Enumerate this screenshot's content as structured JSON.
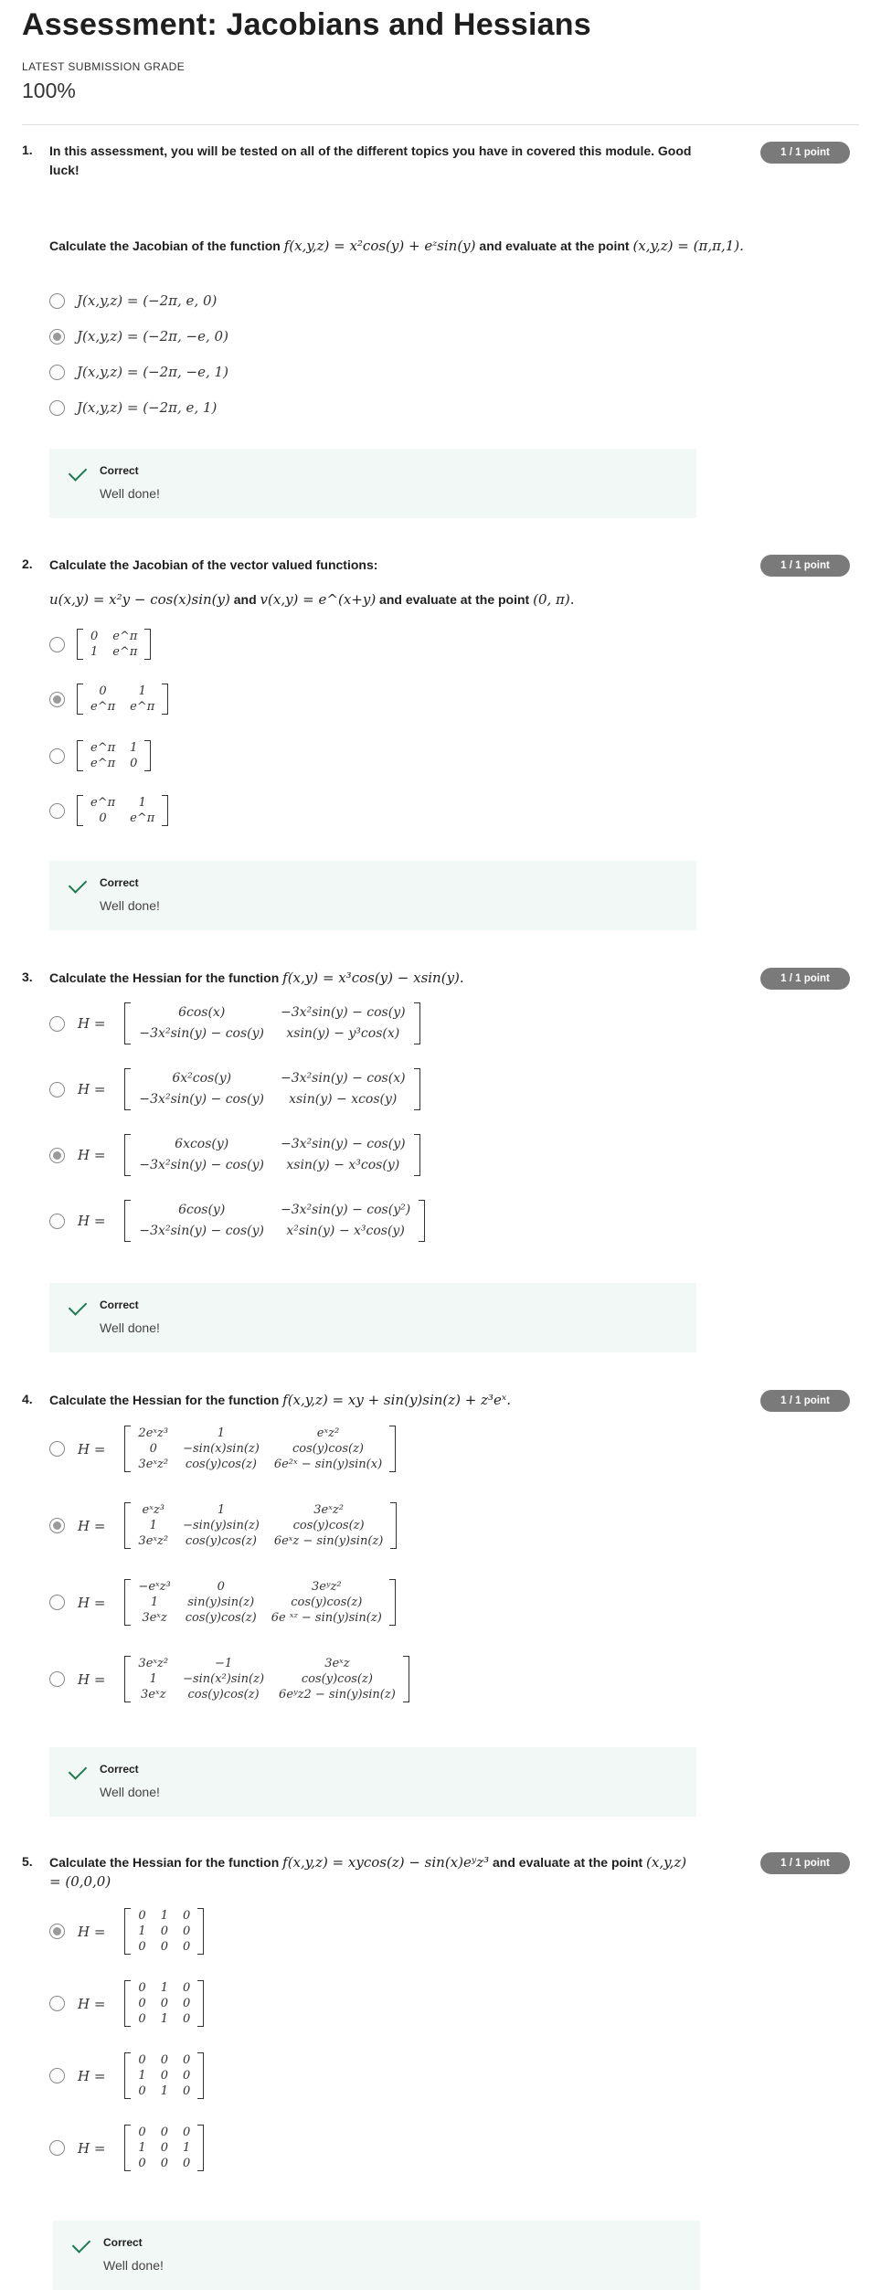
{
  "page": {
    "title": "Assessment: Jacobians and Hessians",
    "grade_label": "LATEST SUBMISSION GRADE",
    "grade_value": "100%"
  },
  "feedback": {
    "title": "Correct",
    "text": "Well done!"
  },
  "questions": [
    {
      "number": "1.",
      "badge": "1 / 1 point",
      "intro": "In this assessment, you will be tested on all of the different topics you have in covered this module. Good luck!",
      "text_parts": [
        "Calculate the Jacobian of the function ",
        "f(x,y,z) = x²cos(y) + eᶻsin(y)",
        " and evaluate at the point ",
        "(x,y,z) = (π,π,1)."
      ],
      "options": [
        "J(x,y,z) = (−2π, e, 0)",
        "J(x,y,z) = (−2π, −e, 0)",
        "J(x,y,z) = (−2π, −e, 1)",
        "J(x,y,z) = (−2π, e, 1)"
      ],
      "selected": 1
    },
    {
      "number": "2.",
      "badge": "1 / 1 point",
      "text": "Calculate the Jacobian of the vector valued functions:",
      "sub_parts": [
        "u(x,y) = x²y − cos(x)sin(y)",
        " and ",
        "v(x,y) = e^(x+y)",
        " and evaluate at the point ",
        "(0, π)."
      ],
      "options": [
        [
          [
            "0",
            "e^π"
          ],
          [
            "1",
            "e^π"
          ]
        ],
        [
          [
            "0",
            "1"
          ],
          [
            "e^π",
            "e^π"
          ]
        ],
        [
          [
            "e^π",
            "1"
          ],
          [
            "e^π",
            "0"
          ]
        ],
        [
          [
            "e^π",
            "1"
          ],
          [
            "0",
            "e^π"
          ]
        ]
      ],
      "selected": 1
    },
    {
      "number": "3.",
      "badge": "1 / 1 point",
      "text_parts": [
        "Calculate the Hessian for the function ",
        "f(x,y) = x³cos(y) − xsin(y)."
      ],
      "h_label": "H =",
      "options": [
        [
          [
            "6cos(x)",
            "−3x²sin(y) − cos(y)"
          ],
          [
            "−3x²sin(y) − cos(y)",
            "xsin(y) − y³cos(x)"
          ]
        ],
        [
          [
            "6x²cos(y)",
            "−3x²sin(y) − cos(x)"
          ],
          [
            "−3x²sin(y) − cos(y)",
            "xsin(y) − xcos(y)"
          ]
        ],
        [
          [
            "6xcos(y)",
            "−3x²sin(y) − cos(y)"
          ],
          [
            "−3x²sin(y) − cos(y)",
            "xsin(y) − x³cos(y)"
          ]
        ],
        [
          [
            "6cos(y)",
            "−3x²sin(y) − cos(y²)"
          ],
          [
            "−3x²sin(y) − cos(y)",
            "x²sin(y) − x³cos(y)"
          ]
        ]
      ],
      "selected": 2
    },
    {
      "number": "4.",
      "badge": "1 / 1 point",
      "text_parts": [
        "Calculate the Hessian for the function ",
        "f(x,y,z) = xy + sin(y)sin(z) + z³eˣ."
      ],
      "h_label": "H =",
      "options": [
        [
          [
            "2eˣz³",
            "1",
            "eˣz²"
          ],
          [
            "0",
            "−sin(x)sin(z)",
            "cos(y)cos(z)"
          ],
          [
            "3eˣz²",
            "cos(y)cos(z)",
            "6e²ˣ − sin(y)sin(x)"
          ]
        ],
        [
          [
            "eˣz³",
            "1",
            "3eˣz²"
          ],
          [
            "1",
            "−sin(y)sin(z)",
            "cos(y)cos(z)"
          ],
          [
            "3eˣz²",
            "cos(y)cos(z)",
            "6eˣz − sin(y)sin(z)"
          ]
        ],
        [
          [
            "−eˣz³",
            "0",
            "3eʸz²"
          ],
          [
            "1",
            "sin(y)sin(z)",
            "cos(y)cos(z)"
          ],
          [
            "3eˣz",
            "cos(y)cos(z)",
            "6e ˣᶻ − sin(y)sin(z)"
          ]
        ],
        [
          [
            "3eˣz²",
            "−1",
            "3eˣz"
          ],
          [
            "1",
            "−sin(x²)sin(z)",
            "cos(y)cos(z)"
          ],
          [
            "3eˣz",
            "cos(y)cos(z)",
            "6eʸz2 − sin(y)sin(z)"
          ]
        ]
      ],
      "selected": 1
    },
    {
      "number": "5.",
      "badge": "1 / 1 point",
      "text_parts": [
        "Calculate the Hessian for the function ",
        "f(x,y,z) = xycos(z) − sin(x)eʸz³",
        " and evaluate at the point ",
        "(x,y,z) = (0,0,0)"
      ],
      "h_label": "H =",
      "options": [
        [
          [
            "0",
            "1",
            "0"
          ],
          [
            "1",
            "0",
            "0"
          ],
          [
            "0",
            "0",
            "0"
          ]
        ],
        [
          [
            "0",
            "1",
            "0"
          ],
          [
            "0",
            "0",
            "0"
          ],
          [
            "0",
            "1",
            "0"
          ]
        ],
        [
          [
            "0",
            "0",
            "0"
          ],
          [
            "1",
            "0",
            "0"
          ],
          [
            "0",
            "1",
            "0"
          ]
        ],
        [
          [
            "0",
            "0",
            "0"
          ],
          [
            "1",
            "0",
            "1"
          ],
          [
            "0",
            "0",
            "0"
          ]
        ]
      ],
      "selected": 0
    }
  ]
}
